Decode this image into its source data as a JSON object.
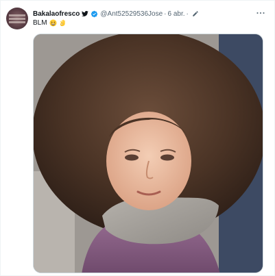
{
  "tweet": {
    "author_name": "Bakalaofresco",
    "handle": "@Ant52529536Jose",
    "separator": "·",
    "time": "6 abr.",
    "time_separator": "·",
    "text": "BLM",
    "emojis": [
      "grinning-squinting-face",
      "ok-hand"
    ],
    "icons": {
      "platform": "twitter-bird-icon",
      "verified": "verified-badge-icon",
      "edited": "pencil-icon",
      "more": "more-options-icon"
    },
    "media": {
      "kind": "photo",
      "description_hidden": true
    }
  },
  "colors": {
    "accent": "#1d9bf0",
    "text": "#0f1419",
    "secondary": "#536471",
    "border": "#cfd9de"
  }
}
